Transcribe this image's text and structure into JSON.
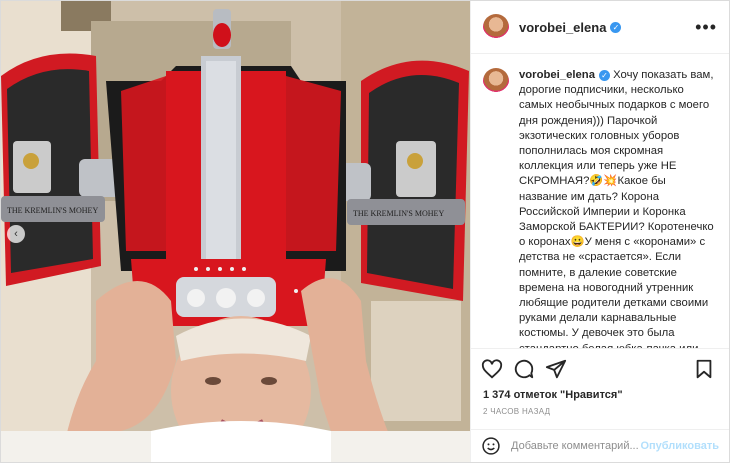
{
  "post": {
    "username": "vorobei_elena",
    "verified_icon": "verified-badge-icon",
    "more_icon": "more-options-icon",
    "caption_text": "Хочу показать вам, дорогие подписчики, несколько самых необычных подарков с моего дня рождения))) Парочкой экзотических головных уборов пополнилась моя скромная коллекция или теперь уже НЕ СКРОМНАЯ?🤣💥Какое бы название им дать? Корона Российской Империи и Коронка Заморской БАКТЕРИИ? Коротенечко о коронах😀У меня с «коронами» с детства не «срастается». Если помните, в далекие советские времена на новогодний утренник любящие родители детками своими руками делали карнавальные костюмы. У девочек это была стандартно белая юбка-пачка или платьице, для",
    "likes": "1 374 отметок \"Нравится\"",
    "time_ago": "2 ЧАСОВ НАЗАД",
    "comment_placeholder": "Добавьте комментарий...",
    "publish_label": "Опубликовать",
    "carousel_prev": "‹",
    "photo_texts": {
      "box_left": "THE KREMLIN'S MOHEY",
      "box_right": "THE KREMLIN'S MOHEY"
    }
  },
  "colors": {
    "accent_blue": "#3897f0",
    "publish_disabled": "#b2dffc",
    "crown_red": "#d8161e",
    "heart_outline": "#262626"
  },
  "icons": [
    "like-icon",
    "comment-icon",
    "share-icon",
    "save-icon",
    "emoji-icon"
  ]
}
